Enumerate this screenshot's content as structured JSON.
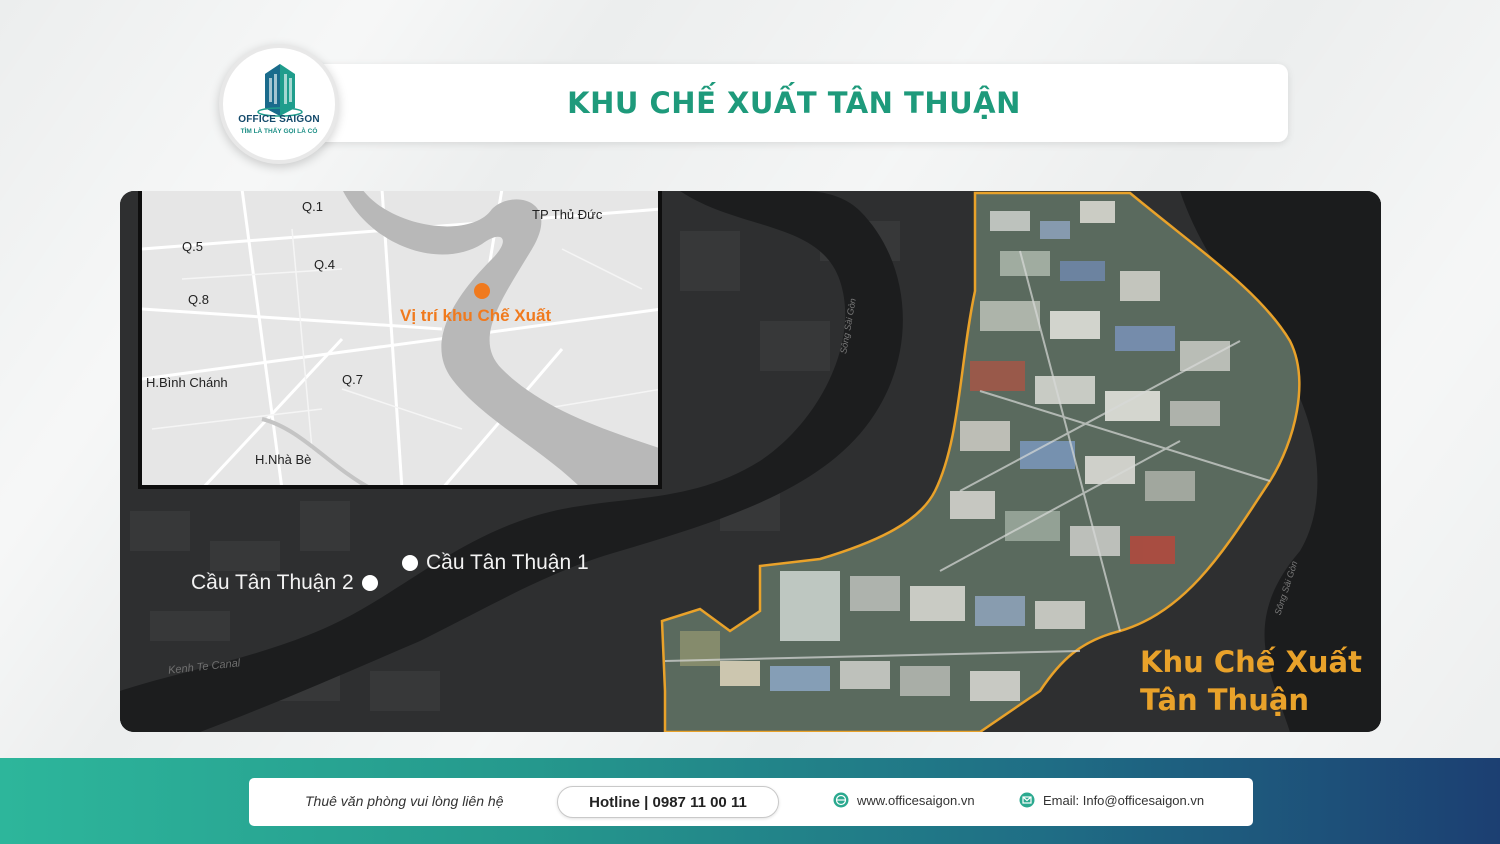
{
  "header": {
    "title": "KHU CHẾ XUẤT TÂN THUẬN",
    "logo": {
      "brand": "OFFICE SAIGON",
      "slogan": "TÌM LÀ THẤY GỌI LÀ CÓ",
      "icon": "building-logo-icon"
    }
  },
  "colors": {
    "accent": "#1e9a7b",
    "orange": "#f07a1e",
    "zone_outline": "#e9a22a"
  },
  "inset_map": {
    "labels": [
      "Q.1",
      "TP Thủ Đức",
      "Q.5",
      "Q.4",
      "Q.8",
      "H.Bình Chánh",
      "Q.7",
      "H.Nhà Bè"
    ],
    "pin_label": "Vị trí khu Chế Xuất"
  },
  "map": {
    "bridges": [
      "Cầu Tân Thuận 1",
      "Cầu Tân Thuận 2"
    ],
    "canal_label": "Kenh Te Canal",
    "river_label": "Sông Sài Gòn",
    "zone_name_line1": "Khu Chế Xuất",
    "zone_name_line2": "Tân Thuận"
  },
  "footer": {
    "contact_text": "Thuê văn phòng vui lòng liên hệ",
    "hotline": "Hotline | 0987 11 00 11",
    "website": "www.officesaigon.vn",
    "website_icon": "globe-icon",
    "email": "Email: Info@officesaigon.vn",
    "email_icon": "mail-icon"
  }
}
